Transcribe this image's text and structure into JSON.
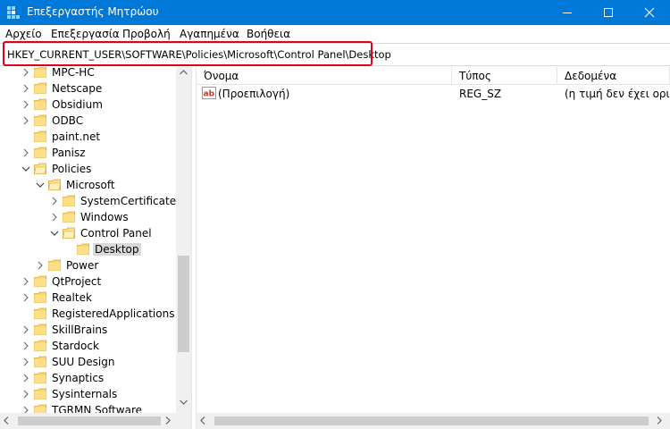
{
  "window": {
    "title": "Επεξεργαστής Μητρώου",
    "accent_color": "#0078d7",
    "highlight_color": "#e3001b"
  },
  "menu": [
    "Αρχείο",
    "Επεξεργασία",
    "Προβολή",
    "Αγαπημένα",
    "Βοήθεια"
  ],
  "address": {
    "path": "HKEY_CURRENT_USER\\SOFTWARE\\Policies\\Microsoft\\Control Panel\\Desktop"
  },
  "tree": {
    "items": [
      {
        "label": "MPC-HC",
        "expander": "collapsed",
        "selected": false
      },
      {
        "label": "Netscape",
        "expander": "collapsed",
        "selected": false
      },
      {
        "label": "Obsidium",
        "expander": "collapsed",
        "selected": false
      },
      {
        "label": "ODBC",
        "expander": "collapsed",
        "selected": false
      },
      {
        "label": "paint.net",
        "expander": "none",
        "selected": false
      },
      {
        "label": "Panisz",
        "expander": "collapsed",
        "selected": false
      },
      {
        "label": "Policies",
        "expander": "expanded",
        "selected": false
      },
      {
        "label": "Microsoft",
        "expander": "expanded",
        "selected": false
      },
      {
        "label": "SystemCertificates",
        "expander": "collapsed",
        "selected": false
      },
      {
        "label": "Windows",
        "expander": "collapsed",
        "selected": false
      },
      {
        "label": "Control Panel",
        "expander": "expanded",
        "selected": false
      },
      {
        "label": "Desktop",
        "expander": "none",
        "selected": true
      },
      {
        "label": "Power",
        "expander": "collapsed",
        "selected": false
      },
      {
        "label": "QtProject",
        "expander": "collapsed",
        "selected": false
      },
      {
        "label": "Realtek",
        "expander": "collapsed",
        "selected": false
      },
      {
        "label": "RegisteredApplications",
        "expander": "none",
        "selected": false
      },
      {
        "label": "SkillBrains",
        "expander": "collapsed",
        "selected": false
      },
      {
        "label": "Stardock",
        "expander": "collapsed",
        "selected": false
      },
      {
        "label": "SUU Design",
        "expander": "collapsed",
        "selected": false
      },
      {
        "label": "Synaptics",
        "expander": "collapsed",
        "selected": false
      },
      {
        "label": "Sysinternals",
        "expander": "collapsed",
        "selected": false
      },
      {
        "label": "TGRMN Software",
        "expander": "collapsed",
        "selected": false
      }
    ]
  },
  "list": {
    "columns": [
      "Όνομα",
      "Τύπος",
      "Δεδομένα"
    ],
    "rows": [
      {
        "icon": "string-value-icon",
        "name": "(Προεπιλογή)",
        "type": "REG_SZ",
        "data": "(η τιμή δεν έχει οριστεί)"
      }
    ]
  }
}
